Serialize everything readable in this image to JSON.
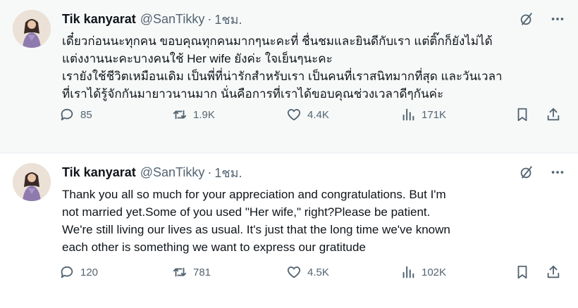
{
  "tweets": [
    {
      "author_name": "Tik kanyarat",
      "handle": "@SanTikky",
      "separator": "·",
      "time": "1ชม.",
      "text": "เดี๋ยวก่อนนะทุกคน ขอบคุณทุกคนมากๆนะคะที่ ชื่นชมและยินดีกับเรา แต่ติ๊กก็ยังไม่ได้\nแต่งงานนะคะบางคนใช้ Her wife ยังค่ะ ใจเย็นๆนะคะ\nเรายังใช้ชีวิตเหมือนเดิม เป็นพี่ที่น่ารักสำหรับเรา เป็นคนที่เราสนิทมากที่สุด และวันเวลา\nที่เราได้รู้จักกันมายาวนานมาก นั่นคือการที่เราได้ขอบคุณช่วงเวลาดีๆกันค่ะ",
      "stats": {
        "replies": "85",
        "retweets": "1.9K",
        "likes": "4.4K",
        "views": "171K"
      }
    },
    {
      "author_name": "Tik kanyarat",
      "handle": "@SanTikky",
      "separator": "·",
      "time": "1ชม.",
      "text": "Thank you all so much for your appreciation and congratulations. But I'm\nnot married yet.Some of you used \"Her wife,\" right?Please be patient.\nWe're still living our lives as usual. It's just that the long time we've known\neach other is something we want to express our gratitude",
      "stats": {
        "replies": "120",
        "retweets": "781",
        "likes": "4.5K",
        "views": "102K"
      }
    }
  ],
  "icons": {
    "header": [
      "grok-icon",
      "more-icon"
    ],
    "actions": [
      "reply-icon",
      "retweet-icon",
      "like-icon",
      "views-icon",
      "bookmark-icon",
      "share-icon"
    ]
  },
  "colors": {
    "text": "#0f1419",
    "muted": "#536471",
    "highlight_bg": "#f7f9f9"
  }
}
